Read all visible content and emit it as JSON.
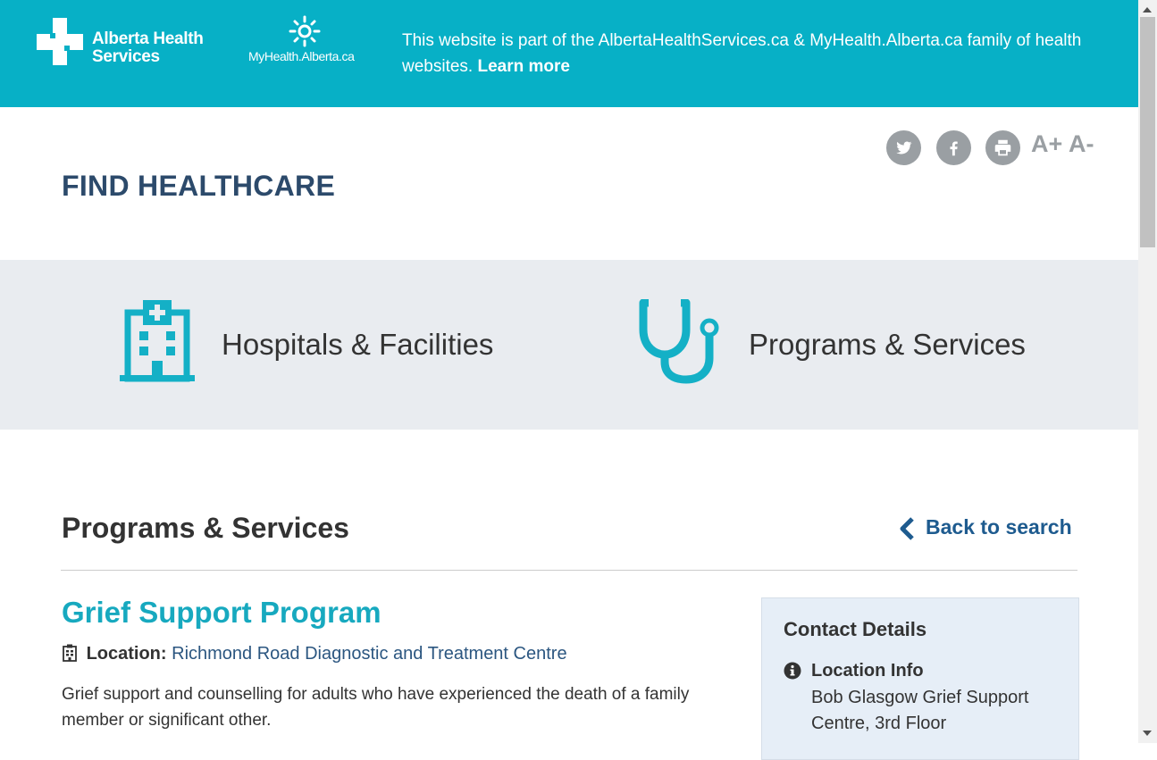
{
  "header": {
    "ahs_logo_text": "Alberta Health Services",
    "myhealth_logo_text": "MyHealth.Alberta.ca",
    "family_note": "This website is part of the AlbertaHealthServices.ca & MyHealth.Alberta.ca family of health websites.",
    "learn_more": "Learn more"
  },
  "tools": {
    "font_increase": "A+",
    "font_decrease": "A-"
  },
  "page_title": "FIND HEALTHCARE",
  "categories": [
    {
      "label": "Hospitals & Facilities",
      "icon": "hospital-building-icon"
    },
    {
      "label": "Programs & Services",
      "icon": "stethoscope-icon"
    }
  ],
  "section": {
    "heading": "Programs & Services",
    "back_link": "Back to search"
  },
  "program": {
    "title": "Grief Support Program",
    "location_label": "Location:",
    "location_value": "Richmond Road Diagnostic and Treatment Centre",
    "description": "Grief support and counselling for adults who have experienced the death of a family member or significant other."
  },
  "contact": {
    "heading": "Contact Details",
    "location_info_label": "Location Info",
    "location_info_text": "Bob Glasgow Grief Support Centre, 3rd Floor"
  },
  "colors": {
    "brand_teal": "#07b0c6",
    "title_navy": "#2c4a6b",
    "link_blue": "#1e5b8f",
    "band_gray": "#e9ecf0"
  }
}
